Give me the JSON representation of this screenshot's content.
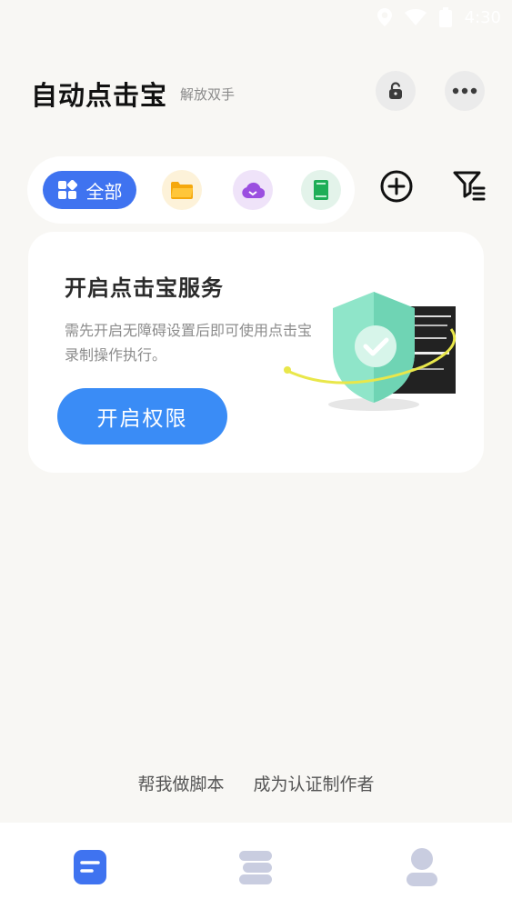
{
  "status_bar": {
    "time": "4:30",
    "icons": [
      "location-icon",
      "wifi-icon",
      "battery-icon"
    ]
  },
  "header": {
    "title": "自动点击宝",
    "subtitle": "解放双手",
    "lock_icon": "lock-icon",
    "more_icon": "more-icon"
  },
  "filter": {
    "all_label": "全部",
    "categories": [
      "folder-icon",
      "cloud-sync-icon",
      "book-icon"
    ],
    "add_icon": "plus-circle-icon",
    "filter_icon": "filter-list-icon"
  },
  "service_card": {
    "title": "开启点击宝服务",
    "description": "需先开启无障碍设置后即可使用点击宝录制操作执行。",
    "button_label": "开启权限"
  },
  "footer_links": {
    "help": "帮我做脚本",
    "certify": "成为认证制作者"
  },
  "bottom_nav": [
    "home-icon",
    "scripts-icon",
    "profile-icon"
  ],
  "colors": {
    "accent": "#3f73f0",
    "button": "#3a8cf6",
    "background": "#f8f7f4",
    "card": "#ffffff"
  }
}
